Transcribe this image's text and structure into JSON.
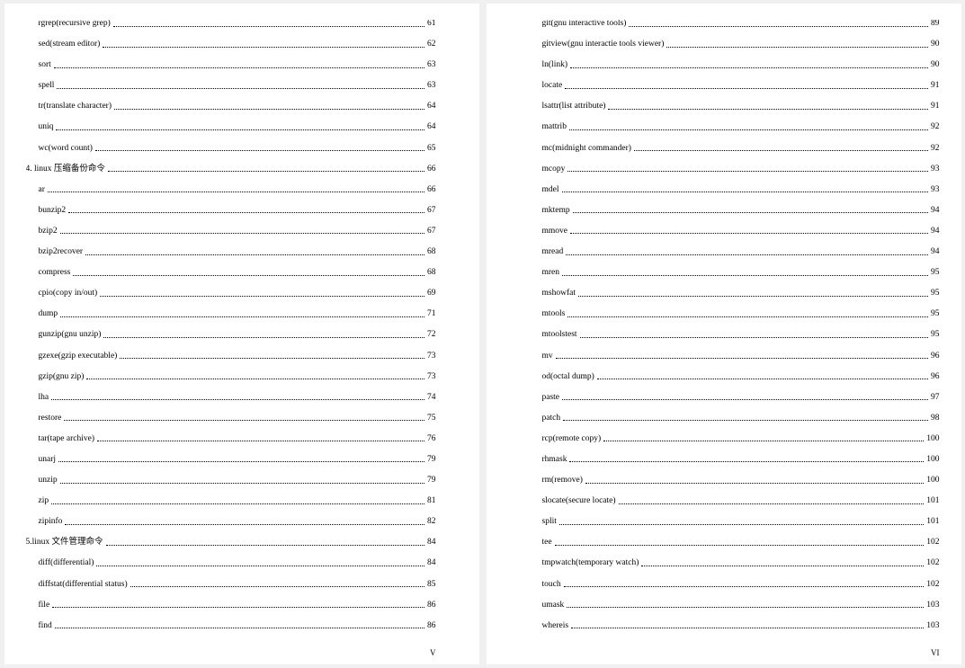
{
  "pages": [
    {
      "footer": "V",
      "entries": [
        {
          "label": "rgrep(recursive grep)",
          "page": "61",
          "level": 2
        },
        {
          "label": "sed(stream editor)",
          "page": "62",
          "level": 2
        },
        {
          "label": "sort",
          "page": "63",
          "level": 2
        },
        {
          "label": "spell",
          "page": "63",
          "level": 2
        },
        {
          "label": "tr(translate character)",
          "page": "64",
          "level": 2
        },
        {
          "label": "uniq",
          "page": "64",
          "level": 2
        },
        {
          "label": "wc(word count)",
          "page": "65",
          "level": 2
        },
        {
          "label": "4. linux 压缩备份命令",
          "page": "66",
          "level": 1
        },
        {
          "label": "ar",
          "page": "66",
          "level": 2
        },
        {
          "label": "bunzip2",
          "page": "67",
          "level": 2
        },
        {
          "label": "bzip2",
          "page": "67",
          "level": 2
        },
        {
          "label": "bzip2recover",
          "page": "68",
          "level": 2
        },
        {
          "label": "compress",
          "page": "68",
          "level": 2
        },
        {
          "label": "cpio(copy in/out)",
          "page": "69",
          "level": 2
        },
        {
          "label": "dump",
          "page": "71",
          "level": 2
        },
        {
          "label": "gunzip(gnu unzip)",
          "page": "72",
          "level": 2
        },
        {
          "label": "gzexe(gzip executable)",
          "page": "73",
          "level": 2
        },
        {
          "label": "gzip(gnu zip)",
          "page": "73",
          "level": 2
        },
        {
          "label": "lha",
          "page": "74",
          "level": 2
        },
        {
          "label": "restore",
          "page": "75",
          "level": 2
        },
        {
          "label": "tar(tape archive)",
          "page": "76",
          "level": 2
        },
        {
          "label": "unarj",
          "page": "79",
          "level": 2
        },
        {
          "label": "unzip",
          "page": "79",
          "level": 2
        },
        {
          "label": "zip",
          "page": "81",
          "level": 2
        },
        {
          "label": "zipinfo",
          "page": "82",
          "level": 2
        },
        {
          "label": "5.linux 文件管理命令",
          "page": "84",
          "level": 1
        },
        {
          "label": "diff(differential)",
          "page": "84",
          "level": 2
        },
        {
          "label": "diffstat(differential status)",
          "page": "85",
          "level": 2
        },
        {
          "label": "file",
          "page": "86",
          "level": 2
        },
        {
          "label": "find",
          "page": "86",
          "level": 2
        }
      ]
    },
    {
      "footer": "VI",
      "entries": [
        {
          "label": "git(gnu interactive tools)",
          "page": "89",
          "level": 2
        },
        {
          "label": "gitview(gnu interactie tools viewer)",
          "page": "90",
          "level": 2
        },
        {
          "label": "ln(link)",
          "page": "90",
          "level": 2
        },
        {
          "label": "locate",
          "page": "91",
          "level": 2
        },
        {
          "label": "lsattr(list attribute)",
          "page": "91",
          "level": 2
        },
        {
          "label": "mattrib",
          "page": "92",
          "level": 2
        },
        {
          "label": "mc(midnight commander)",
          "page": "92",
          "level": 2
        },
        {
          "label": "mcopy",
          "page": "93",
          "level": 2
        },
        {
          "label": "mdel",
          "page": "93",
          "level": 2
        },
        {
          "label": "mktemp",
          "page": "94",
          "level": 2
        },
        {
          "label": "mmove",
          "page": "94",
          "level": 2
        },
        {
          "label": "mread",
          "page": "94",
          "level": 2
        },
        {
          "label": "mren",
          "page": "95",
          "level": 2
        },
        {
          "label": "mshowfat",
          "page": "95",
          "level": 2
        },
        {
          "label": "mtools",
          "page": "95",
          "level": 2
        },
        {
          "label": "mtoolstest",
          "page": "95",
          "level": 2
        },
        {
          "label": "mv",
          "page": "96",
          "level": 2
        },
        {
          "label": "od(octal dump)",
          "page": "96",
          "level": 2
        },
        {
          "label": "paste",
          "page": "97",
          "level": 2
        },
        {
          "label": "patch",
          "page": "98",
          "level": 2
        },
        {
          "label": "rcp(remote copy)",
          "page": "100",
          "level": 2
        },
        {
          "label": "rhmask",
          "page": "100",
          "level": 2
        },
        {
          "label": "rm(remove)",
          "page": "100",
          "level": 2
        },
        {
          "label": "slocate(secure locate)",
          "page": "101",
          "level": 2
        },
        {
          "label": "split",
          "page": "101",
          "level": 2
        },
        {
          "label": "tee",
          "page": "102",
          "level": 2
        },
        {
          "label": "tmpwatch(temporary watch)",
          "page": "102",
          "level": 2
        },
        {
          "label": "touch",
          "page": "102",
          "level": 2
        },
        {
          "label": "umask",
          "page": "103",
          "level": 2
        },
        {
          "label": "whereis",
          "page": "103",
          "level": 2
        }
      ]
    }
  ]
}
